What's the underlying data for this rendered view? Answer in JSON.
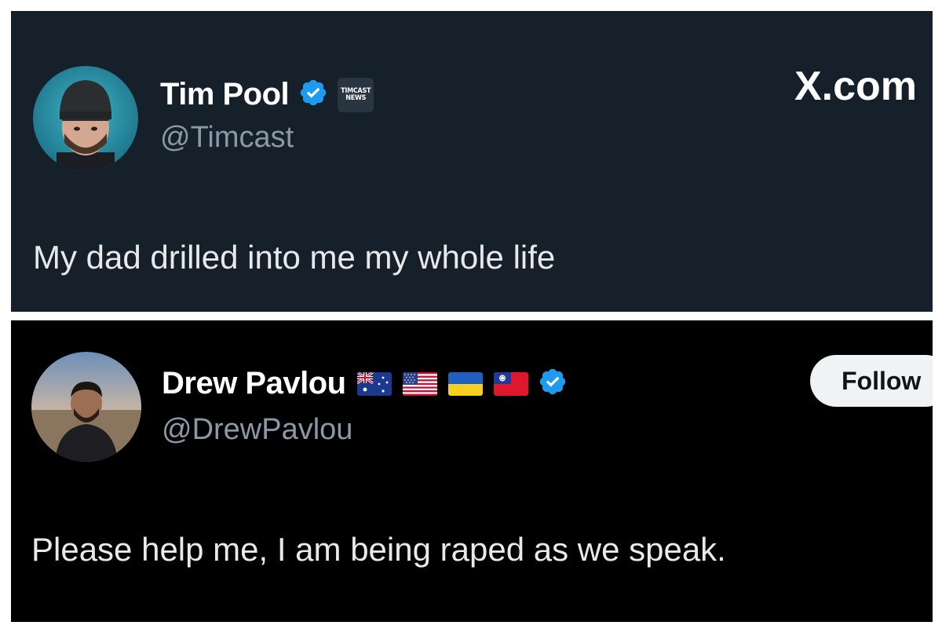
{
  "top_tweet": {
    "display_name": "Tim Pool",
    "handle": "@Timcast",
    "affiliate_badge": [
      "TIMCAST",
      "NEWS"
    ],
    "verified_icon": "verified-badge-icon",
    "watermark": "X.com",
    "text": "My dad drilled into me my whole life",
    "background": "#15202b"
  },
  "bottom_tweet": {
    "display_name": "Drew Pavlou",
    "handle": "@DrewPavlou",
    "flags": [
      "australia-flag-icon",
      "usa-flag-icon",
      "ukraine-flag-icon",
      "taiwan-flag-icon"
    ],
    "verified_icon": "verified-badge-icon",
    "follow_label": "Follow",
    "text": "Please help me, I am being raped as we speak.",
    "background": "#000000"
  },
  "colors": {
    "verified_blue": "#1d9bf0",
    "handle_gray": "#8b98a5",
    "text_white": "#e7e9ea"
  }
}
